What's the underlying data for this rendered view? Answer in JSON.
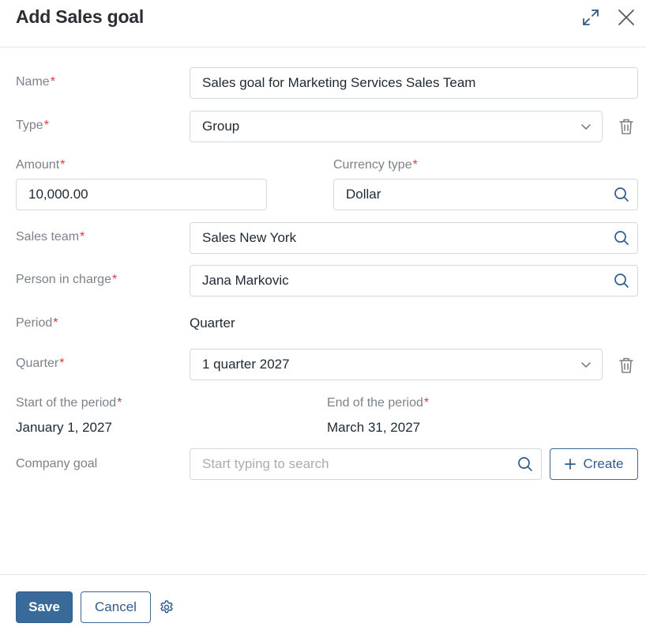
{
  "dialog": {
    "title": "Add Sales goal",
    "icons": {
      "expand": "expand-icon",
      "close": "close-icon"
    }
  },
  "form": {
    "name": {
      "label": "Name",
      "value": "Sales goal for Marketing Services Sales Team"
    },
    "type": {
      "label": "Type",
      "value": "Group"
    },
    "amount": {
      "label": "Amount",
      "value": "10,000.00"
    },
    "currency_type": {
      "label": "Currency type",
      "value": "Dollar"
    },
    "sales_team": {
      "label": "Sales team",
      "value": "Sales New York"
    },
    "person_in_charge": {
      "label": "Person in charge",
      "value": "Jana Markovic"
    },
    "period": {
      "label": "Period",
      "value": "Quarter"
    },
    "quarter": {
      "label": "Quarter",
      "value": "1 quarter 2027"
    },
    "start_of_period": {
      "label": "Start of the period",
      "value": "January 1, 2027"
    },
    "end_of_period": {
      "label": "End of the period",
      "value": "March 31, 2027"
    },
    "company_goal": {
      "label": "Company goal",
      "placeholder": "Start typing to search",
      "create_label": "Create"
    },
    "required_marker": "*"
  },
  "footer": {
    "save_label": "Save",
    "cancel_label": "Cancel"
  },
  "colors": {
    "accent": "#3a6a99",
    "required": "#d83a3a",
    "label": "#7b8289",
    "border": "#d3d8dd"
  }
}
